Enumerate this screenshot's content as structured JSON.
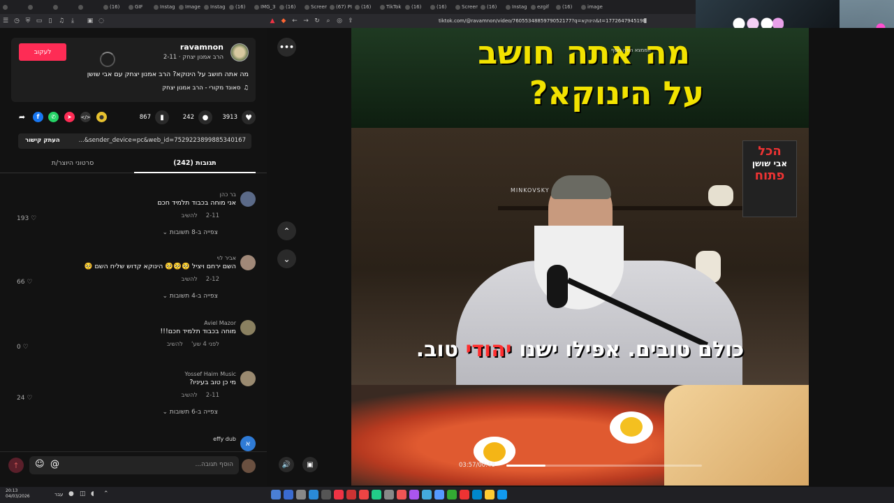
{
  "tabs": [
    {
      "label": ""
    },
    {
      "label": ""
    },
    {
      "label": ""
    },
    {
      "label": ""
    },
    {
      "label": "(16)"
    },
    {
      "label": "GIF"
    },
    {
      "label": "Instag"
    },
    {
      "label": "Image"
    },
    {
      "label": "Instag"
    },
    {
      "label": "(16)"
    },
    {
      "label": "IMG_3"
    },
    {
      "label": "(16)"
    },
    {
      "label": "Screen"
    },
    {
      "label": "(67) PI"
    },
    {
      "label": "(16)"
    },
    {
      "label": "TikTok"
    },
    {
      "label": "(16)"
    },
    {
      "label": "(16)"
    },
    {
      "label": "Screen"
    },
    {
      "label": "(16)"
    },
    {
      "label": "Instag"
    },
    {
      "label": "ezgif"
    },
    {
      "label": "(16)"
    },
    {
      "label": "image"
    }
  ],
  "browser": {
    "url": "tiktok.com/@ravamnon/video/7605534885979052177?q=הינוקא&t=1772647945198"
  },
  "author": {
    "username": "ravamnon",
    "display_meta": "הרב אמנון יצחק · 2-11",
    "follow_label": "לעקוב",
    "caption": "מה אתה חושב על הינוקא? הרב אמנון יצחק עם אבי שושן",
    "sound": "סאונד מקורי - הרב אמנון יצחק"
  },
  "stats": {
    "likes": "3913",
    "comments": "242",
    "saves": "867"
  },
  "share": {
    "link": "...&sender_device=pc&web_id=7529223899885340167",
    "copy_label": "העתק קישור"
  },
  "tabs_panel": {
    "comments_tab": "תגובות (242)",
    "creator_tab": "סרטוני היוצר/ת"
  },
  "comments": [
    {
      "name": "בר כהן",
      "text": "אני מוחה בכבוד תלמיד חכם",
      "date": "2-11",
      "reply": "להשיב",
      "likes": "193",
      "replies": "צפייה ב-8 תשובות"
    },
    {
      "name": "אביר לוי",
      "text": "השם ירחם ויציל 🥺🥺🥺 הינוקא קדוש שליח השם 🥺",
      "date": "2-12",
      "reply": "להשיב",
      "likes": "66",
      "replies": "צפייה ב-4 תשובות"
    },
    {
      "name": "Aviel Mazor",
      "text": "מוחה בכבוד תלמיד חכם!!!",
      "date": "לפני 4 שע'",
      "reply": "להשיב",
      "likes": "0",
      "replies": ""
    },
    {
      "name": "Yossef Haim Music",
      "text": "מי כן טוב בעיניו?",
      "date": "2-11",
      "reply": "להשיב",
      "likes": "24",
      "replies": "צפייה ב-6 תשובות"
    },
    {
      "name": "effy dub",
      "text": "",
      "date": "",
      "reply": "",
      "likes": "",
      "replies": ""
    }
  ],
  "comment_input": {
    "placeholder": "הוסף תגובה..."
  },
  "video": {
    "headline_line1": "מה אתה חושב",
    "headline_line2": "על הינוקא?",
    "small_tag": "הממצא הודה ויוסף",
    "subtitle_part1": "כולם טובים. אפילו ישנו ",
    "subtitle_highlight": "יהודי",
    "subtitle_part2": " טוב.",
    "show_title_1": "הכל",
    "show_title_2": "אבי שושן",
    "show_title_3": "פתוח",
    "brand": "MINKOVSKY",
    "time": "03:57/00:48",
    "progress": 0.2
  },
  "taskbar": {
    "time": "20:13",
    "date": "04/03/2026",
    "lang": "עבר"
  },
  "colors": {
    "follow": "#fe2c55",
    "headline": "#f2e200",
    "subtitle_highlight": "#ff2e2e"
  }
}
